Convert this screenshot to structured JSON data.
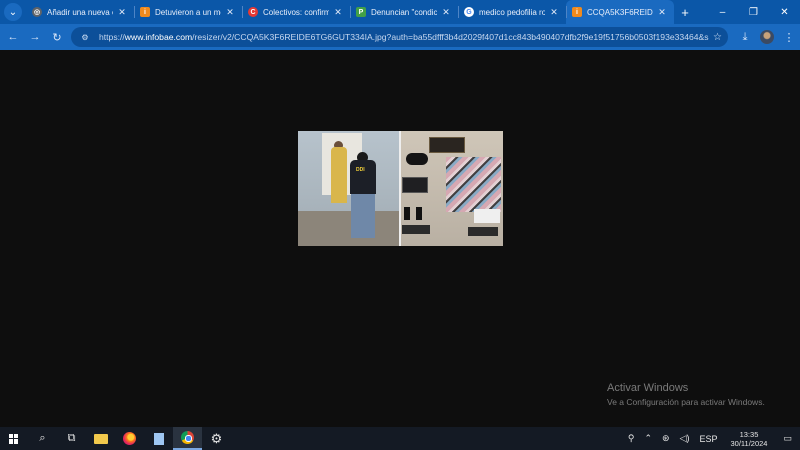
{
  "browser": {
    "tabs": [
      {
        "title": "Añadir una nueva ent",
        "favicon": "add-tab-favicon",
        "favicon_color": "#5f6368",
        "active": false
      },
      {
        "title": "Detuvieron a un méd",
        "favicon": "infobae-favicon",
        "favicon_color": "#f08a1d",
        "active": false
      },
      {
        "title": "Colectivos: confirman",
        "favicon": "news-favicon",
        "favicon_color": "#e53935",
        "active": false
      },
      {
        "title": "Denuncian \"condicio",
        "favicon": "news-favicon",
        "favicon_color": "#2e7d32",
        "active": false
      },
      {
        "title": "medico pedofilia rop",
        "favicon": "google-favicon",
        "favicon_color": "#4285f4",
        "active": false
      },
      {
        "title": "CCQA5K3F6REIDE6TG",
        "favicon": "infobae-favicon",
        "favicon_color": "#f08a1d",
        "active": true
      }
    ],
    "new_tab": "+",
    "window_controls": {
      "minimize": "–",
      "restore": "❐",
      "close": "✕"
    },
    "address_bar": {
      "prefix": "https://",
      "domain": "www.infobae.com",
      "path": "/resizer/v2/CCQA5K3F6REIDE6TG6GUT334IA.jpg?auth=ba55dfff3b4d2029f407d1cc843b490407dfb2f9e19f51756b0503f193e33464&smart=tru..."
    }
  },
  "watermark": {
    "line1": "Activar Windows",
    "line2": "Ve a Configuración para activar Windows."
  },
  "taskbar": {
    "language": "ESP",
    "time": "13:35",
    "date": "30/11/2024"
  },
  "image_text": {
    "badge": "DDI"
  }
}
